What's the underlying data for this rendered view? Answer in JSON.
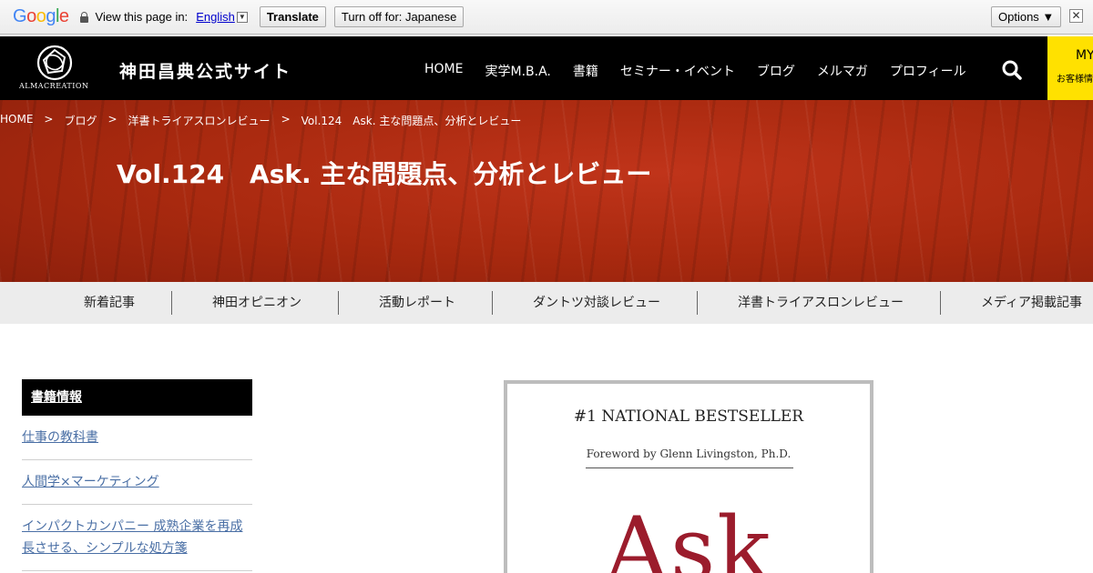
{
  "translate_bar": {
    "logo": [
      "G",
      "o",
      "o",
      "g",
      "l",
      "e"
    ],
    "view_label": "View this page in:",
    "language": "English",
    "caret": "▼",
    "translate_button": "Translate",
    "turn_off_button": "Turn off for: Japanese",
    "options_button": "Options ▼",
    "close": "✕"
  },
  "header": {
    "logo_text": "ALMACREATION",
    "site_title": "神田昌典公式サイト",
    "nav": [
      "HOME",
      "実学M.B.A.",
      "書籍",
      "セミナー・イベント",
      "ブログ",
      "メルマガ",
      "プロフィール"
    ],
    "mypage_big": "MY",
    "mypage_small": "お客様情報"
  },
  "hero": {
    "breadcrumb": [
      "HOME",
      "ブログ",
      "洋書トライアスロンレビュー",
      "Vol.124　Ask. 主な問題点、分析とレビュー"
    ],
    "separator": ">",
    "title": "Vol.124　Ask. 主な問題点、分析とレビュー",
    "colors": {
      "base": "#a8290f",
      "text": "#ffffff"
    }
  },
  "categories": [
    "新着記事",
    "神田オピニオン",
    "活動レポート",
    "ダントツ対談レビュー",
    "洋書トライアスロンレビュー",
    "メディア掲載記事"
  ],
  "sidebar": {
    "heading": "書籍情報",
    "items": [
      "仕事の教科書",
      "人間学×マーケティング",
      "インパクトカンパニー 成熟企業を再成長させる、シンプルな処方箋"
    ]
  },
  "book": {
    "top_line": "#1 NATIONAL BESTSELLER",
    "foreword": "Foreword by Glenn Livingston, Ph.D.",
    "title": "Ask",
    "title_color": "#9b1c2c"
  }
}
